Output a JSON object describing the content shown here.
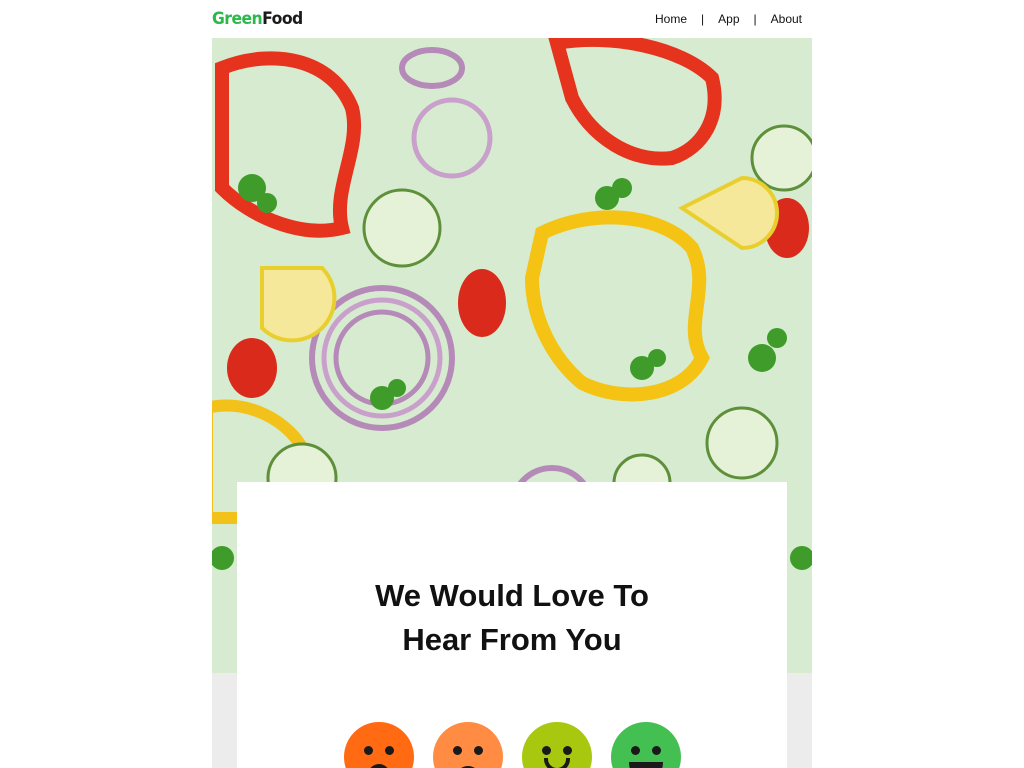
{
  "brand": {
    "part1": "Green",
    "part2": "Food"
  },
  "nav": {
    "items": [
      "Home",
      "App",
      "About"
    ],
    "separator": "|"
  },
  "hero": {
    "alt": "Colorful sliced vegetables on light green background"
  },
  "card": {
    "heading_line1": "We Would Love To",
    "heading_line2": "Hear From You"
  },
  "ratings": [
    {
      "name": "very-unhappy",
      "color": "#ff6a13"
    },
    {
      "name": "unhappy",
      "color": "#ff8c42"
    },
    {
      "name": "happy",
      "color": "#a7c80e"
    },
    {
      "name": "very-happy",
      "color": "#44c053"
    }
  ],
  "colors": {
    "brand_green": "#2db84b",
    "hero_bg": "#d8ecd2",
    "band": "#ececec"
  }
}
